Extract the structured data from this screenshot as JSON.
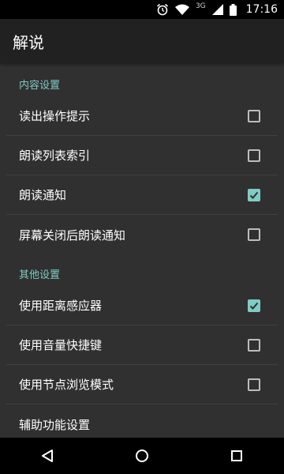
{
  "status_bar": {
    "network_label": "3G",
    "time": "17:16",
    "icons": [
      "alarm-icon",
      "wifi-icon",
      "cellular-signal-icon",
      "battery-icon"
    ]
  },
  "app_bar": {
    "title": "解说"
  },
  "sections": [
    {
      "header": "内容设置",
      "items": [
        {
          "label": "读出操作提示",
          "checked": false
        },
        {
          "label": "朗读列表索引",
          "checked": false
        },
        {
          "label": "朗读通知",
          "checked": true
        },
        {
          "label": "屏幕关闭后朗读通知",
          "checked": false
        }
      ]
    },
    {
      "header": "其他设置",
      "items": [
        {
          "label": "使用距离感应器",
          "checked": true
        },
        {
          "label": "使用音量快捷键",
          "checked": false
        },
        {
          "label": "使用节点浏览模式",
          "checked": false
        },
        {
          "label": "辅助功能设置"
        }
      ]
    }
  ],
  "colors": {
    "accent": "#80cbc4",
    "background": "#303030",
    "app_bar": "#212121",
    "system_bars": "#000000"
  },
  "nav_bar": {
    "icons": [
      "back-icon",
      "home-icon",
      "recents-icon"
    ]
  }
}
